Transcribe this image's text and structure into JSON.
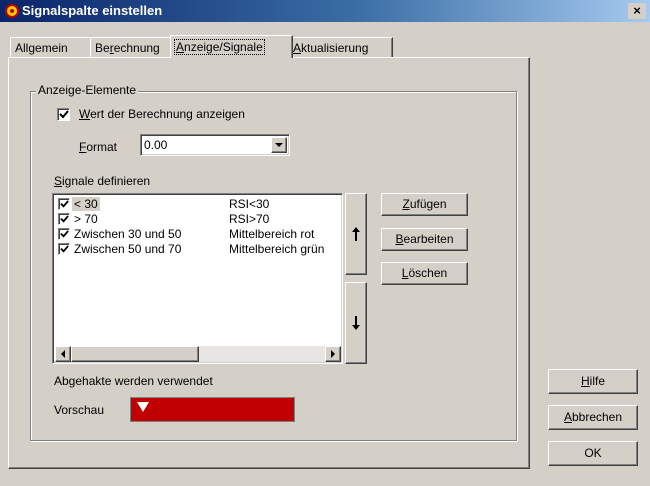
{
  "window": {
    "title": "Signalspalte einstellen",
    "close_glyph": "×"
  },
  "tabs": [
    {
      "pre": "All",
      "ul": "g",
      "post": "emein"
    },
    {
      "pre": "Be",
      "ul": "r",
      "post": "echnung"
    },
    {
      "pre": "",
      "ul": "A",
      "post": "nzeige/Signale"
    },
    {
      "pre": "",
      "ul": "A",
      "post": "ktualisierung"
    }
  ],
  "group": {
    "title": "Anzeige-Elemente"
  },
  "show_value": {
    "pre": "",
    "ul": "W",
    "post": "ert der Berechnung anzeigen",
    "checked": true
  },
  "format": {
    "pre": "",
    "ul": "F",
    "post": "ormat",
    "value": "0.00"
  },
  "signals": {
    "pre": "",
    "ul": "S",
    "post": "ignale definieren",
    "rows": [
      {
        "name": "< 30",
        "description": "RSI<30",
        "checked": true
      },
      {
        "name": "> 70",
        "description": "RSI>70",
        "checked": true
      },
      {
        "name": "Zwischen 30 und 50",
        "description": "Mittelbereich rot",
        "checked": true
      },
      {
        "name": "Zwischen 50 und 70",
        "description": "Mittelbereich grün",
        "checked": true
      }
    ]
  },
  "actions": {
    "add": {
      "pre": "",
      "ul": "Z",
      "post": "ufügen"
    },
    "edit": {
      "pre": "",
      "ul": "B",
      "post": "earbeiten"
    },
    "delete": {
      "pre": "",
      "ul": "L",
      "post": "öschen"
    }
  },
  "used_note": "Abgehakte werden verwendet",
  "preview": {
    "label": "Vorschau",
    "color": "#c00000",
    "marker_color": "#ffffff"
  },
  "dialog_buttons": {
    "help": {
      "pre": "",
      "ul": "H",
      "post": "ilfe"
    },
    "cancel": {
      "pre": "",
      "ul": "A",
      "post": "bbrechen"
    },
    "ok": "OK"
  }
}
